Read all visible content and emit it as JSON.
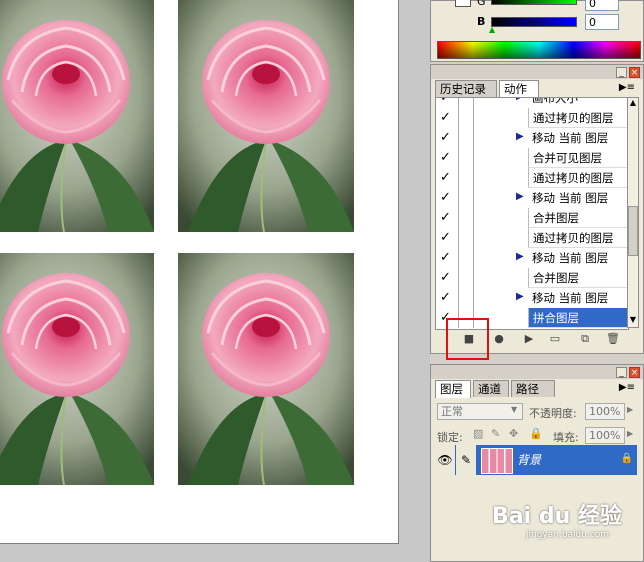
{
  "colors": {
    "selection": "#3169c6",
    "highlight_box": "#e01010",
    "panel_bg": "#ece9d8"
  },
  "color_panel": {
    "channels": [
      {
        "label": "G",
        "value": "0"
      },
      {
        "label": "B",
        "value": "0"
      }
    ]
  },
  "actions_panel": {
    "tabs": [
      "历史记录",
      "动作"
    ],
    "active_tab": "动作",
    "rows": [
      {
        "label": "画布大小",
        "has_triangle": true
      },
      {
        "label": "通过拷贝的图层",
        "has_triangle": false
      },
      {
        "label": "移动 当前 图层",
        "has_triangle": true
      },
      {
        "label": "合并可见图层",
        "has_triangle": false
      },
      {
        "label": "通过拷贝的图层",
        "has_triangle": false
      },
      {
        "label": "移动 当前 图层",
        "has_triangle": true
      },
      {
        "label": "合并图层",
        "has_triangle": false
      },
      {
        "label": "通过拷贝的图层",
        "has_triangle": false
      },
      {
        "label": "移动 当前 图层",
        "has_triangle": true
      },
      {
        "label": "合并图层",
        "has_triangle": false
      },
      {
        "label": "移动 当前 图层",
        "has_triangle": true
      },
      {
        "label": "拼合图层",
        "has_triangle": false,
        "selected": true
      }
    ],
    "footer_icons": [
      "stop-icon",
      "record-icon",
      "play-icon",
      "new-set-icon",
      "new-action-icon",
      "delete-icon"
    ]
  },
  "layers_panel": {
    "tabs": [
      "图层",
      "通道",
      "路径"
    ],
    "active_tab": "图层",
    "blend_mode": "正常",
    "opacity_label": "不透明度:",
    "opacity_value": "100%",
    "lock_label": "锁定:",
    "fill_label": "填充:",
    "fill_value": "100%",
    "layer_name": "背景"
  },
  "watermark": {
    "text": "Bai du 经验",
    "sub": "jingyan.baidu.com"
  }
}
